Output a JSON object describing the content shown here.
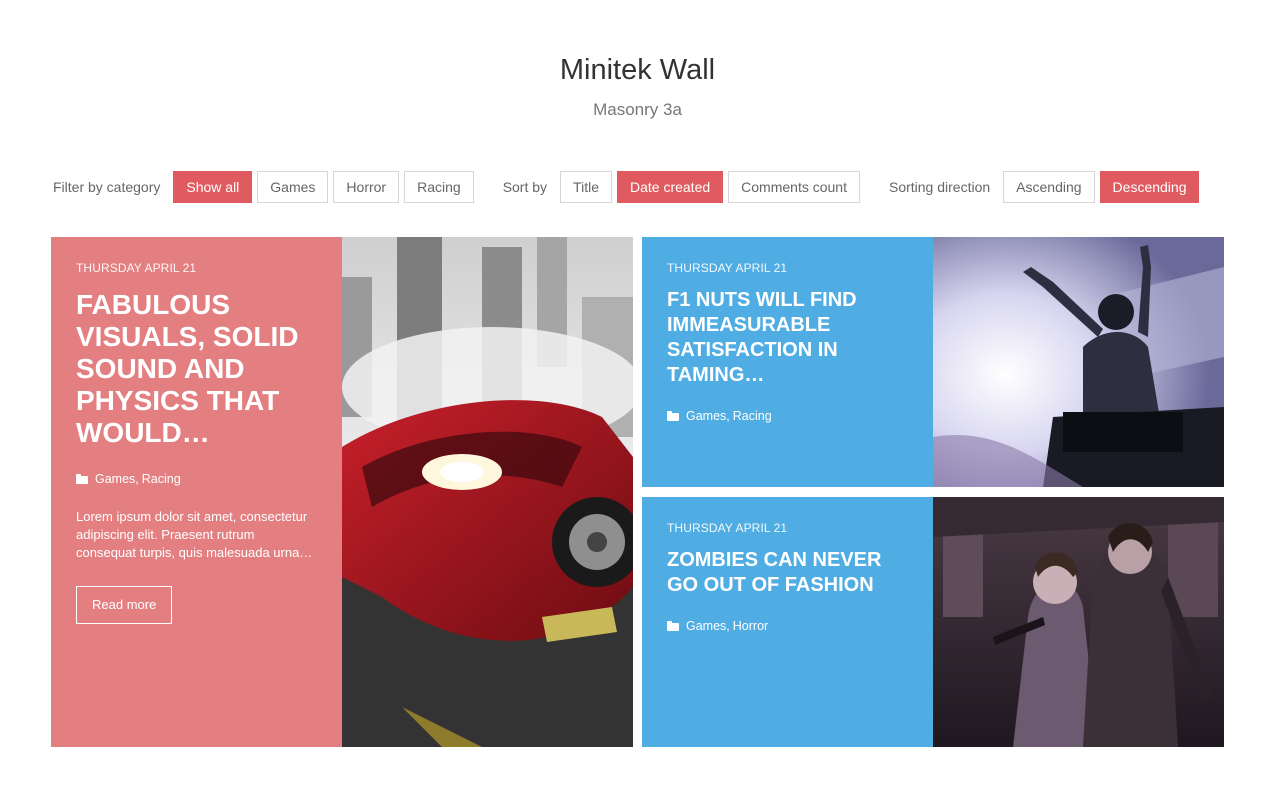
{
  "header": {
    "title": "Minitek Wall",
    "subtitle": "Masonry 3a"
  },
  "filters": {
    "category_label": "Filter by category",
    "categories": [
      "Show all",
      "Games",
      "Horror",
      "Racing"
    ],
    "active_category": "Show all",
    "sort_label": "Sort by",
    "sort_options": [
      "Title",
      "Date created",
      "Comments count"
    ],
    "active_sort": "Date created",
    "direction_label": "Sorting direction",
    "direction_options": [
      "Ascending",
      "Descending"
    ],
    "active_direction": "Descending"
  },
  "colors": {
    "accent": "#e05b5f",
    "card_red": "#e47f81",
    "card_blue": "#4fade4"
  },
  "cards": [
    {
      "date": "THURSDAY APRIL 21",
      "title": "FABULOUS VISUALS, SOLID SOUND AND PHYSICS THAT WOULD…",
      "categories": [
        "Games",
        "Racing"
      ],
      "excerpt": "Lorem ipsum dolor sit amet, consectetur adipiscing elit. Praesent rutrum consequat turpis, quis malesuada urna…",
      "read_more": "Read more",
      "image": "red-sports-car-city"
    },
    {
      "date": "THURSDAY APRIL 21",
      "title": "F1 NUTS WILL FIND IMMEASURABLE SATISFACTION IN TAMING…",
      "categories": [
        "Games",
        "Racing"
      ],
      "image": "racing-driver-celebrating"
    },
    {
      "date": "THURSDAY APRIL 21",
      "title": "ZOMBIES CAN NEVER GO OUT OF FASHION",
      "categories": [
        "Games",
        "Horror"
      ],
      "image": "zombie-game-characters"
    }
  ]
}
